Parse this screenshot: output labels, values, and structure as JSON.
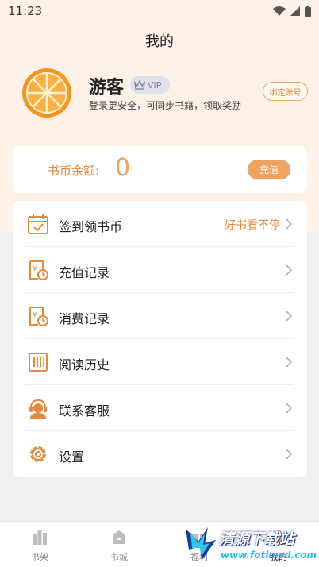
{
  "status_bar": {
    "time": "11:23"
  },
  "header": {
    "title": "我的"
  },
  "profile": {
    "username": "游客",
    "vip_label": "VIP",
    "subtitle": "登录更安全，可同步书籍，领取奖励",
    "bind_button": "绑定账号"
  },
  "balance": {
    "label": "书币余额:",
    "value": "0",
    "recharge_button": "充值"
  },
  "menu": {
    "items": [
      {
        "label": "签到领书币",
        "extra": "好书看不停",
        "icon": "calendar-check-icon"
      },
      {
        "label": "充值记录",
        "extra": "",
        "icon": "recharge-record-icon"
      },
      {
        "label": "消费记录",
        "extra": "",
        "icon": "consume-record-icon"
      },
      {
        "label": "阅读历史",
        "extra": "",
        "icon": "reading-history-icon"
      },
      {
        "label": "联系客服",
        "extra": "",
        "icon": "customer-service-icon"
      },
      {
        "label": "设置",
        "extra": "",
        "icon": "settings-gear-icon"
      }
    ]
  },
  "bottom_nav": {
    "items": [
      {
        "label": "书架",
        "icon": "bookshelf-icon"
      },
      {
        "label": "书城",
        "icon": "bookstore-icon"
      },
      {
        "label": "福利",
        "icon": "gift-icon"
      },
      {
        "label": "我的",
        "icon": "profile-icon"
      }
    ]
  },
  "watermark": {
    "title": "清源下载站",
    "url": "www.fotimsd.com"
  },
  "colors": {
    "accent": "#f0a25e",
    "accent_text": "#e8883a",
    "header_bg": "#fdf1e8"
  }
}
